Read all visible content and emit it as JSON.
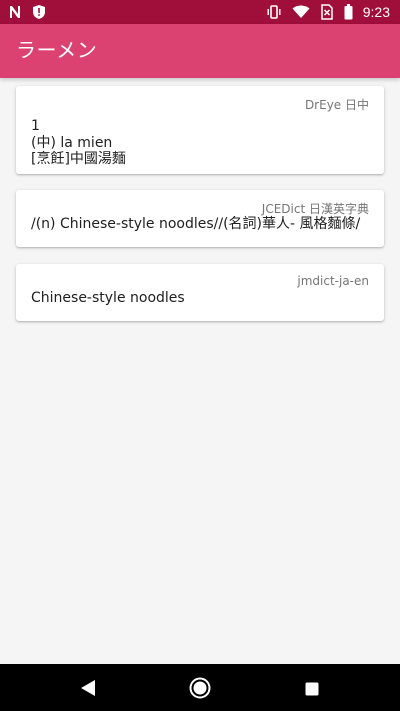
{
  "status_bar": {
    "left_icons": [
      "n-notification-icon",
      "shield-alert-icon"
    ],
    "right_icons": [
      "vibrate-icon",
      "wifi-icon",
      "no-sim-icon",
      "battery-icon"
    ],
    "time": "9:23"
  },
  "app_bar": {
    "title": "ラーメン",
    "background_color": "#db4272",
    "status_bar_color": "#a00e3a"
  },
  "results": [
    {
      "source": "DrEye 日中",
      "lines": [
        "1",
        "(中) la mien",
        "[烹飪]中國湯麵"
      ]
    },
    {
      "source": "JCEDict 日漢英字典",
      "lines": [
        "/(n) Chinese-style noodles//(名詞)華人- 風格麵條/"
      ]
    },
    {
      "source": "jmdict-ja-en",
      "lines": [
        "Chinese-style noodles"
      ]
    }
  ],
  "nav_bar": {
    "buttons": [
      "back-icon",
      "home-icon",
      "recents-icon"
    ]
  }
}
